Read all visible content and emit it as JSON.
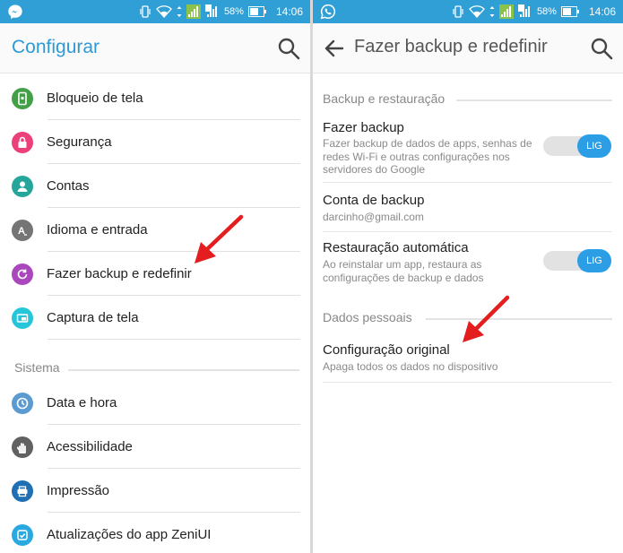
{
  "colors": {
    "status_bar": "#2f9fd6",
    "accent": "#2d9ad6",
    "toggle_on": "#2c9ee6",
    "arrow": "#e41e1e"
  },
  "left": {
    "status": {
      "app_icon": "messenger-icon",
      "battery": "58%",
      "time": "14:06"
    },
    "title": "Configurar",
    "items": [
      {
        "label": "Bloqueio de tela",
        "icon": "lock-screen-icon",
        "color": "#43a047"
      },
      {
        "label": "Segurança",
        "icon": "padlock-icon",
        "color": "#ec407a"
      },
      {
        "label": "Contas",
        "icon": "person-icon",
        "color": "#26a69a"
      },
      {
        "label": "Idioma e entrada",
        "icon": "language-icon",
        "color": "#757575"
      },
      {
        "label": "Fazer backup e redefinir",
        "icon": "backup-icon",
        "color": "#ab47bc"
      },
      {
        "label": "Captura de tela",
        "icon": "screenshot-icon",
        "color": "#26c6da"
      }
    ],
    "section": "Sistema",
    "system_items": [
      {
        "label": "Data e hora",
        "icon": "clock-icon",
        "color": "#5c9bd1"
      },
      {
        "label": "Acessibilidade",
        "icon": "hand-icon",
        "color": "#616161"
      },
      {
        "label": "Impressão",
        "icon": "printer-icon",
        "color": "#1e6fb3"
      },
      {
        "label": "Atualizações do app ZeniUI",
        "icon": "update-icon",
        "color": "#29a9e0"
      }
    ]
  },
  "right": {
    "status": {
      "app_icon": "whatsapp-icon",
      "battery": "58%",
      "time": "14:06"
    },
    "title": "Fazer backup e redefinir",
    "section1": "Backup e restauração",
    "backup": {
      "title": "Fazer backup",
      "subtitle_lines": [
        "Fazer backup de dados de apps, senhas de",
        "redes Wi-Fi e outras configurações nos",
        "servidores do Google"
      ],
      "toggle": "LIG"
    },
    "account": {
      "title": "Conta de backup",
      "subtitle": "darcinho@gmail.com"
    },
    "restore": {
      "title": "Restauração automática",
      "subtitle_lines": [
        "Ao reinstalar um app, restaura as",
        "configurações de backup e dados"
      ],
      "toggle": "LIG"
    },
    "section2": "Dados pessoais",
    "factory": {
      "title": "Configuração original",
      "subtitle": "Apaga todos os dados no dispositivo"
    }
  }
}
